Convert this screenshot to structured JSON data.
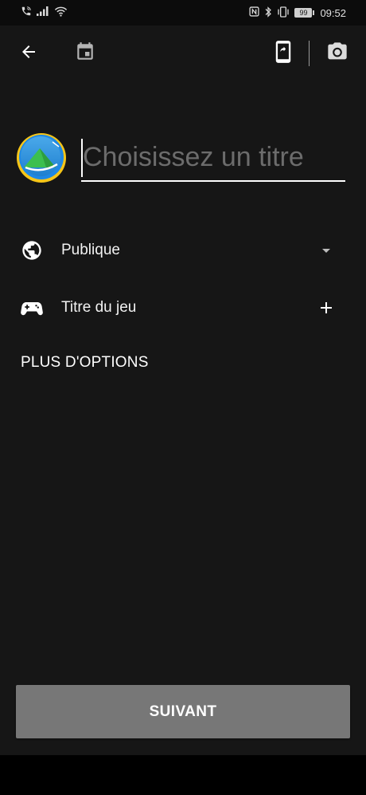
{
  "status_bar": {
    "left_icons": [
      "wifi-calling-icon",
      "signal-icon",
      "wifi-icon"
    ],
    "right_icons": [
      "nfc-icon",
      "bluetooth-icon",
      "vibrate-icon"
    ],
    "battery": "99",
    "time": "09:52"
  },
  "toolbar": {
    "back_icon": "arrow-left-icon",
    "schedule_icon": "calendar-icon",
    "screen_share_icon": "phone-share-icon",
    "camera_icon": "camera-icon"
  },
  "title_input": {
    "placeholder": "Choisissez un titre",
    "value": ""
  },
  "privacy_row": {
    "label": "Publique",
    "icon": "globe-icon",
    "action_icon": "dropdown-arrow-icon"
  },
  "game_row": {
    "label": "Titre du jeu",
    "icon": "gamepad-icon",
    "action_icon": "plus-icon"
  },
  "more_options": {
    "label": "PLUS D'OPTIONS"
  },
  "next_button": {
    "label": "SUIVANT"
  },
  "colors": {
    "background": "#161616",
    "status_bar": "#0c0c0c",
    "button": "#777777",
    "placeholder": "#6c6c6c",
    "text": "#ffffff"
  }
}
